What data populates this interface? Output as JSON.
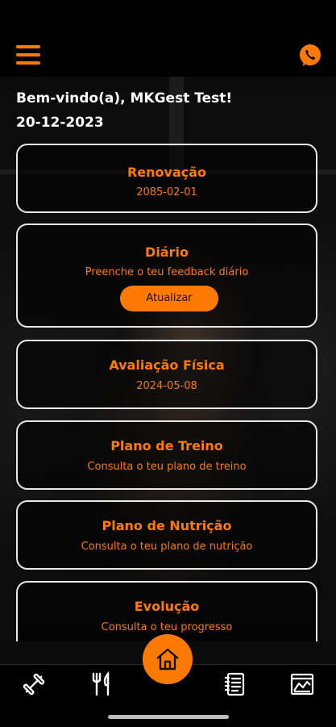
{
  "colors": {
    "accent": "#ff7a00",
    "background": "#000000",
    "card_border": "#e8e8e8"
  },
  "header": {
    "menu_icon": "hamburger-menu-icon",
    "contact_icon": "whatsapp-icon"
  },
  "greeting": {
    "welcome": "Bem-vindo(a), MKGest Test!",
    "date": "20-12-2023"
  },
  "cards": [
    {
      "title": "Renovação",
      "subtitle": "2085-02-01"
    },
    {
      "title": "Diário",
      "subtitle": "Preenche o teu feedback diário",
      "button": "Atualizar"
    },
    {
      "title": "Avaliação Física",
      "subtitle": "2024-05-08"
    },
    {
      "title": "Plano de Treino",
      "subtitle": "Consulta o teu plano de treino"
    },
    {
      "title": "Plano de Nutrição",
      "subtitle": "Consulta o teu plano de nutrição"
    },
    {
      "title": "Evolução",
      "subtitle": "Consulta o teu progresso"
    }
  ],
  "bottom_nav": {
    "items": [
      {
        "icon": "dumbbell-icon"
      },
      {
        "icon": "fork-knife-icon"
      },
      {
        "icon": "home-icon",
        "active": true
      },
      {
        "icon": "notebook-icon"
      },
      {
        "icon": "chart-icon"
      }
    ]
  }
}
